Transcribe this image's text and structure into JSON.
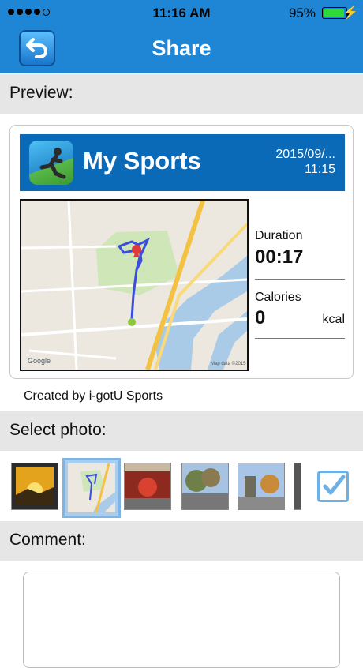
{
  "status_bar": {
    "time": "11:16 AM",
    "battery_pct": "95%",
    "signal_bars_filled": 4,
    "battery_color": "#2ed83a"
  },
  "nav": {
    "title": "Share",
    "back_icon": "back-arrow-icon",
    "bar_color": "#1f86d6"
  },
  "preview": {
    "header": "Preview:",
    "card": {
      "title": "My Sports",
      "date": "2015/09/...",
      "time": "11:15",
      "header_color": "#0b6ab7",
      "duration_label": "Duration",
      "duration_value": "00:17",
      "calories_label": "Calories",
      "calories_value": "0",
      "calories_unit": "kcal"
    },
    "created_by": "Created by i-gotU Sports"
  },
  "photos": {
    "header": "Select photo:",
    "selected_index": 1,
    "count": 6,
    "checkbox_checked": true
  },
  "comment": {
    "header": "Comment:",
    "placeholder": ""
  }
}
